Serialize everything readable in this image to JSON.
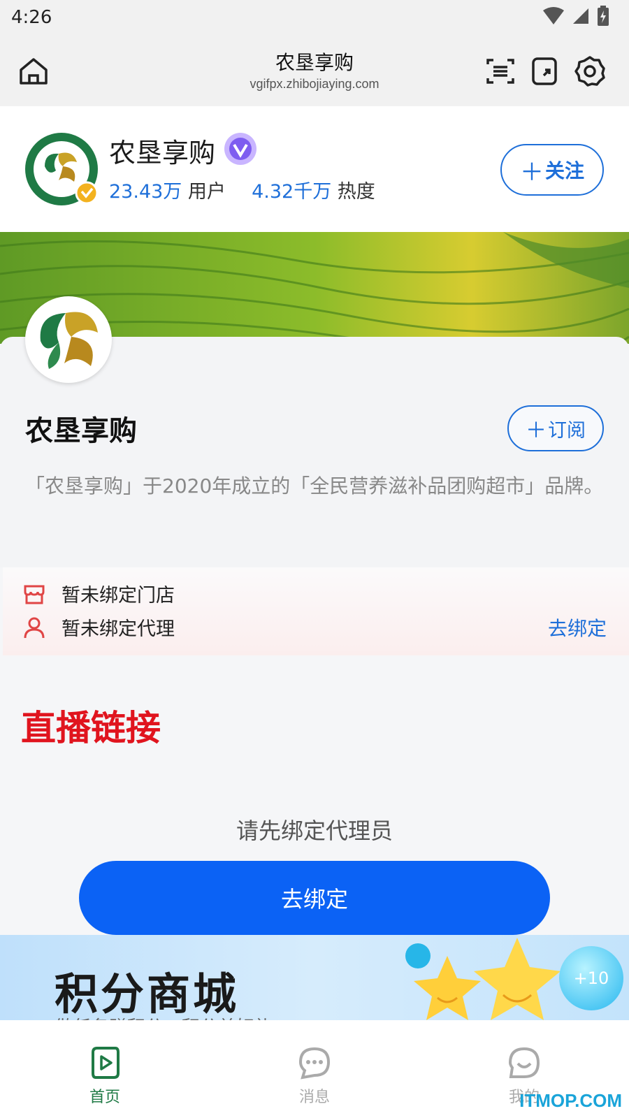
{
  "status_bar": {
    "time": "4:26"
  },
  "header": {
    "title": "农垦享购",
    "url": "vgifpx.zhibojiaying.com"
  },
  "profile": {
    "name": "农垦享购",
    "users_value": "23.43万",
    "users_label": "用户",
    "heat_value": "4.32千万",
    "heat_label": "热度",
    "follow_label": "关注"
  },
  "shop": {
    "name": "农垦享购",
    "subscribe_label": "订阅",
    "description": "「农垦享购」于2020年成立的「全民营养滋补品团购超市」品牌。"
  },
  "binding": {
    "store_status": "暂未绑定门店",
    "agent_status": "暂未绑定代理",
    "bind_link": "去绑定"
  },
  "live": {
    "title": "直播链接",
    "prompt": "请先绑定代理员",
    "button_label": "去绑定"
  },
  "mall": {
    "title": "积分商城",
    "subtitle": "做任务赚积分，积分兑好礼",
    "plus_badge": "+10"
  },
  "bottom_nav": [
    {
      "label": "首页",
      "active": true
    },
    {
      "label": "消息",
      "active": false
    },
    {
      "label": "我的",
      "active": false
    }
  ],
  "colors": {
    "accent": "#1e6fd9",
    "live_red": "#e0141e",
    "active_green": "#1f7a45"
  },
  "watermark": "ITMOP.COM"
}
